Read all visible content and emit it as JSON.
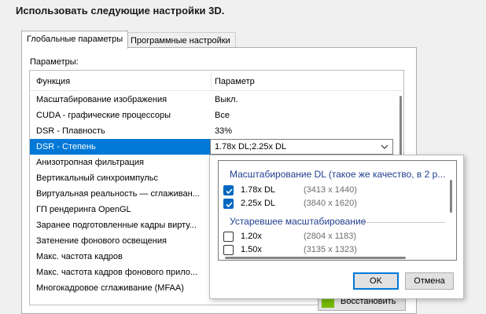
{
  "heading": "Использовать следующие настройки 3D.",
  "tabs": [
    {
      "label": "Глобальные параметры",
      "active": true
    },
    {
      "label": "Программные настройки",
      "active": false
    }
  ],
  "params_label": "Параметры:",
  "columns": {
    "function": "Функция",
    "param": "Параметр"
  },
  "rows": [
    {
      "function": "Масштабирование изображения",
      "value": "Выкл."
    },
    {
      "function": "CUDA - графические процессоры",
      "value": "Все"
    },
    {
      "function": "DSR - Плавность",
      "value": "33%"
    },
    {
      "function": "DSR - Степень",
      "value": "1.78x DL;2.25x DL",
      "selected": true
    },
    {
      "function": "Анизотропная фильтрация",
      "value": ""
    },
    {
      "function": "Вертикальный синхроимпульс",
      "value": ""
    },
    {
      "function": "Виртуальная реальность — сглаживан...",
      "value": ""
    },
    {
      "function": "ГП рендеринга OpenGL",
      "value": ""
    },
    {
      "function": "Заранее подготовленные кадры вирту...",
      "value": ""
    },
    {
      "function": "Затенение фонового освещения",
      "value": ""
    },
    {
      "function": "Макс. частота кадров",
      "value": ""
    },
    {
      "function": "Макс. частота кадров фонового прило...",
      "value": ""
    },
    {
      "function": "Многокадровое сглаживание (MFAA)",
      "value": ""
    }
  ],
  "restore_button": "Восстановить",
  "popup": {
    "group1": "Масштабирование DL (такое же качество, в 2 р...",
    "group1_options": [
      {
        "label": "1.78x DL",
        "res": "(3413 x 1440)",
        "checked": true
      },
      {
        "label": "2.25x DL",
        "res": "(3840 x 1620)",
        "checked": true
      }
    ],
    "group2": "Устаревшее масштабирование",
    "group2_options": [
      {
        "label": "1.20x",
        "res": "(2804 x 1183)",
        "checked": false
      },
      {
        "label": "1.50x",
        "res": "(3135 x 1323)",
        "checked": false
      }
    ],
    "ok": "OK",
    "cancel": "Отмена"
  },
  "colors": {
    "selection": "#0078d7",
    "group_header": "#1f3e8f",
    "checkbox": "#0067c0",
    "nvidia": "#76b900"
  },
  "icons": {
    "dropdown": "chevron-down-icon",
    "restore": "nvidia-logo-icon",
    "checkmark": "checkmark-icon"
  }
}
